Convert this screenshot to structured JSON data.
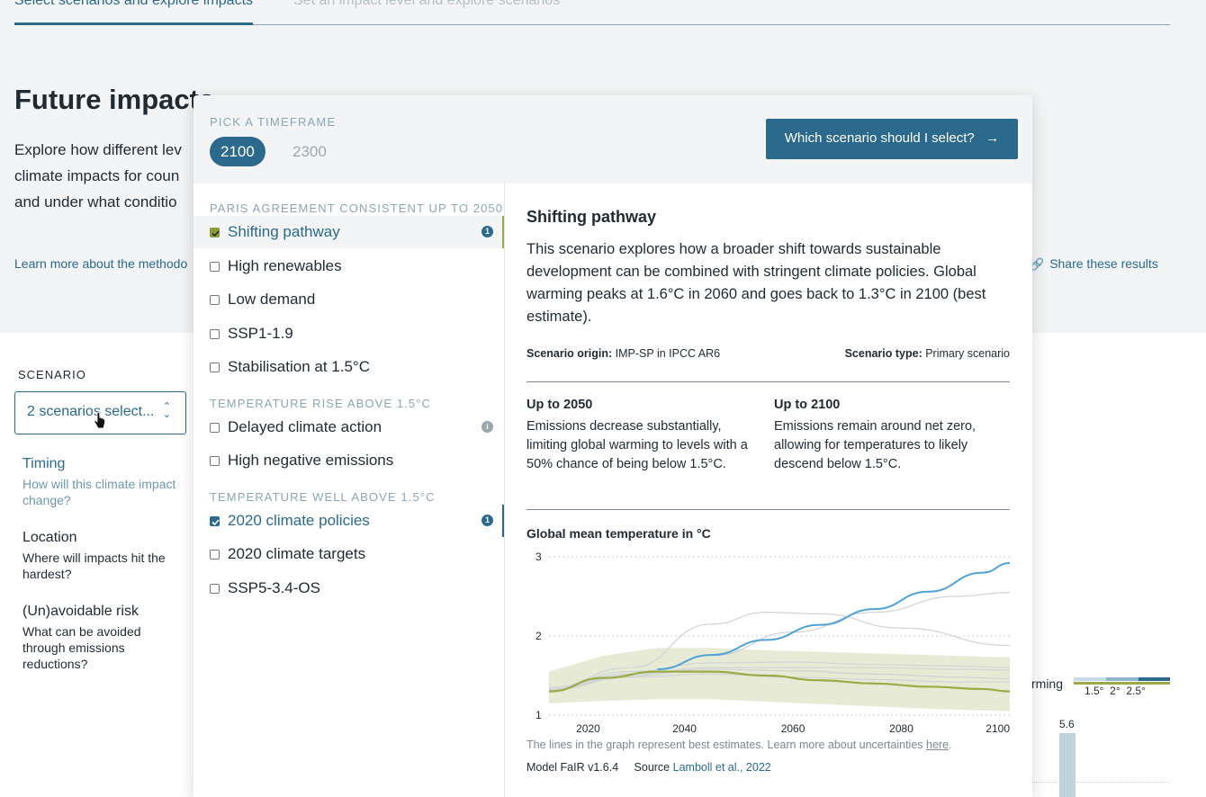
{
  "tabs": {
    "active": "Select scenarios and explore impacts",
    "inactive": "Set an impact level and explore scenarios"
  },
  "page": {
    "title": "Future impacts",
    "intro_line1": "Explore how different lev",
    "intro_line2": "climate impacts for coun",
    "intro_line3": "and under what conditio",
    "learn_link": "Learn more about the methodo",
    "share_link": "Share these results"
  },
  "scenario": {
    "label": "SCENARIO",
    "select_value": "2 scenarios select..."
  },
  "side_nav": [
    {
      "title": "Timing",
      "subtitle": "How will this climate impact change?"
    },
    {
      "title": "Location",
      "subtitle": "Where will impacts hit the hardest?"
    },
    {
      "title": "(Un)avoidable risk",
      "subtitle": "What can be avoided through emissions reductions?"
    }
  ],
  "background_legend": {
    "partial_label": "rming",
    "ticks": [
      "1.5°",
      "2°",
      "2.5°"
    ],
    "bar_value": "5.6",
    "colors": [
      "#c8dce8",
      "#8fb5cc",
      "#2b6a8c"
    ]
  },
  "popup": {
    "pick_label": "PICK A TIMEFRAME",
    "timeframes": [
      "2100",
      "2300"
    ],
    "active_timeframe": "2100",
    "which_button": "Which scenario should I select?",
    "groups": [
      {
        "label": "PARIS AGREEMENT CONSISTENT UP TO 2050"
      },
      {
        "label": "TEMPERATURE RISE ABOVE 1.5°C"
      },
      {
        "label": "TEMPERATURE WELL ABOVE 1.5°C"
      }
    ],
    "scenarios": [
      {
        "label": "Shifting pathway",
        "checked": true,
        "info": "1"
      },
      {
        "label": "High renewables",
        "checked": false
      },
      {
        "label": "Low demand",
        "checked": false
      },
      {
        "label": "SSP1-1.9",
        "checked": false
      },
      {
        "label": "Stabilisation at 1.5°C",
        "checked": false
      },
      {
        "label": "Delayed climate action",
        "checked": false,
        "info": "i"
      },
      {
        "label": "High negative emissions",
        "checked": false
      },
      {
        "label": "2020 climate policies",
        "checked": true,
        "info": "1"
      },
      {
        "label": "2020 climate targets",
        "checked": false
      },
      {
        "label": "SSP5-3.4-OS",
        "checked": false
      }
    ],
    "detail": {
      "title": "Shifting pathway",
      "description": "This scenario explores how a broader shift towards sustainable development can be combined with stringent climate policies. Global warming peaks at 1.6°C in 2060 and goes back to 1.3°C in 2100 (best estimate).",
      "origin_label": "Scenario origin:",
      "origin_value": "IMP-SP in IPCC AR6",
      "type_label": "Scenario type:",
      "type_value": "Primary scenario",
      "period1_title": "Up to 2050",
      "period1_text": "Emissions decrease substantially, limiting global warming to levels with a 50% chance of being below 1.5°C.",
      "period2_title": "Up to 2100",
      "period2_text": "Emissions remain around net zero, allowing for temperatures to likely descend below 1.5°C.",
      "chart_title": "Global mean temperature in °C",
      "note_prefix": "The lines in the graph represent best estimates. Learn more about uncertainties ",
      "note_link": "here",
      "note_suffix": ".",
      "model_label": "Model",
      "model_value": "FaIR v1.6.4",
      "source_label": "Source",
      "source_value": "Lamboll et al., 2022"
    }
  },
  "chart_data": {
    "type": "line",
    "title": "Global mean temperature in °C",
    "xlabel": "",
    "ylabel": "",
    "xlim": [
      2015,
      2100
    ],
    "ylim": [
      1,
      3
    ],
    "x_ticks": [
      "2020",
      "2040",
      "2060",
      "2080",
      "2100"
    ],
    "y_ticks": [
      "1",
      "2",
      "3"
    ],
    "grid": true,
    "colors": {
      "selected": "#9aab45",
      "band": "#e7ebd6",
      "policies": "#4fa3d6",
      "other": "#cfd3d6"
    },
    "uncertainty_band": {
      "x": [
        2015,
        2025,
        2035,
        2045,
        2055,
        2065,
        2075,
        2085,
        2095,
        2100
      ],
      "lower": [
        1.15,
        1.18,
        1.2,
        1.2,
        1.17,
        1.14,
        1.11,
        1.08,
        1.06,
        1.05
      ],
      "upper": [
        1.55,
        1.75,
        1.85,
        1.85,
        1.82,
        1.8,
        1.78,
        1.76,
        1.74,
        1.73
      ]
    },
    "series": [
      {
        "name": "Shifting pathway",
        "x": [
          2015,
          2025,
          2035,
          2045,
          2055,
          2065,
          2075,
          2085,
          2095,
          2100
        ],
        "values": [
          1.3,
          1.47,
          1.55,
          1.55,
          1.5,
          1.44,
          1.4,
          1.36,
          1.33,
          1.3
        ]
      },
      {
        "name": "2020 climate policies",
        "x": [
          2035,
          2045,
          2055,
          2065,
          2075,
          2085,
          2095,
          2100
        ],
        "values": [
          1.58,
          1.76,
          1.95,
          2.14,
          2.34,
          2.56,
          2.8,
          2.92
        ]
      },
      {
        "name": "",
        "x": [
          2015,
          2030,
          2045,
          2055,
          2065,
          2080,
          2100
        ],
        "values": [
          1.35,
          1.6,
          2.15,
          2.3,
          2.28,
          2.1,
          1.88
        ]
      },
      {
        "name": "",
        "x": [
          2045,
          2060,
          2075,
          2090,
          2100
        ],
        "values": [
          1.75,
          2.05,
          2.3,
          2.5,
          2.55
        ]
      },
      {
        "name": "",
        "x": [
          2015,
          2030,
          2045,
          2060,
          2075,
          2090,
          2100
        ],
        "values": [
          1.35,
          1.55,
          1.66,
          1.67,
          1.64,
          1.62,
          1.6
        ]
      },
      {
        "name": "",
        "x": [
          2015,
          2030,
          2045,
          2060,
          2075,
          2090,
          2100
        ],
        "values": [
          1.32,
          1.5,
          1.58,
          1.56,
          1.52,
          1.48,
          1.46
        ]
      },
      {
        "name": "",
        "x": [
          2015,
          2030,
          2045,
          2060,
          2075,
          2090,
          2100
        ],
        "values": [
          1.33,
          1.52,
          1.6,
          1.6,
          1.6,
          1.58,
          1.57
        ]
      },
      {
        "name": "",
        "x": [
          2015,
          2030,
          2045,
          2060,
          2075,
          2090,
          2100
        ],
        "values": [
          1.32,
          1.48,
          1.52,
          1.48,
          1.45,
          1.42,
          1.42
        ]
      }
    ]
  }
}
